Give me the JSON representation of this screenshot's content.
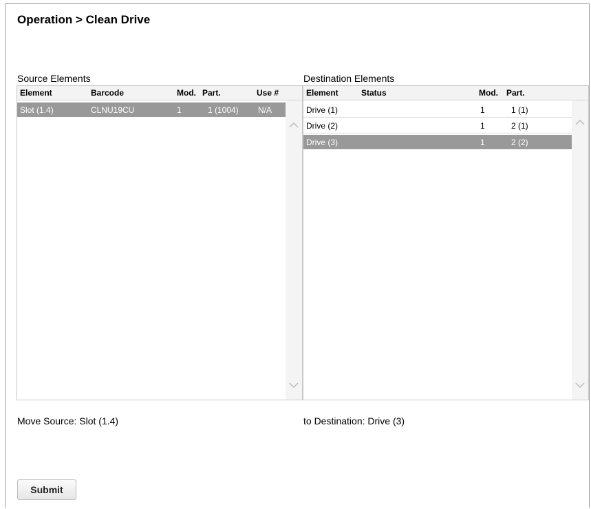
{
  "page": {
    "title": "Operation > Clean Drive"
  },
  "source": {
    "label": "Source Elements",
    "columns": [
      "Element",
      "Barcode",
      "Mod.",
      "Part.",
      "Use #"
    ],
    "rows": [
      {
        "element": "Slot (1.4)",
        "barcode": "CLNU19CU",
        "mod": "1",
        "part": "1 (1004)",
        "use": "N/A",
        "selected": true
      }
    ]
  },
  "destination": {
    "label": "Destination Elements",
    "columns": [
      "Element",
      "Status",
      "Mod.",
      "Part."
    ],
    "rows": [
      {
        "element": "Drive (1)",
        "status": "",
        "mod": "1",
        "part": "1 (1)",
        "selected": false
      },
      {
        "element": "Drive (2)",
        "status": "",
        "mod": "1",
        "part": "2 (1)",
        "selected": false
      },
      {
        "element": "Drive (3)",
        "status": "",
        "mod": "1",
        "part": "2 (2)",
        "selected": true
      }
    ]
  },
  "footer": {
    "move_source": "Move Source: Slot (1.4)",
    "to_destination": "to Destination: Drive (3)"
  },
  "actions": {
    "submit_label": "Submit"
  },
  "colors": {
    "selected_row": "#999999",
    "header_bg": "#f3f3f3",
    "scroll_bg": "#f4f4f4"
  },
  "icons": {
    "scroll_up": "chevron-up-icon",
    "scroll_down": "chevron-down-icon"
  }
}
